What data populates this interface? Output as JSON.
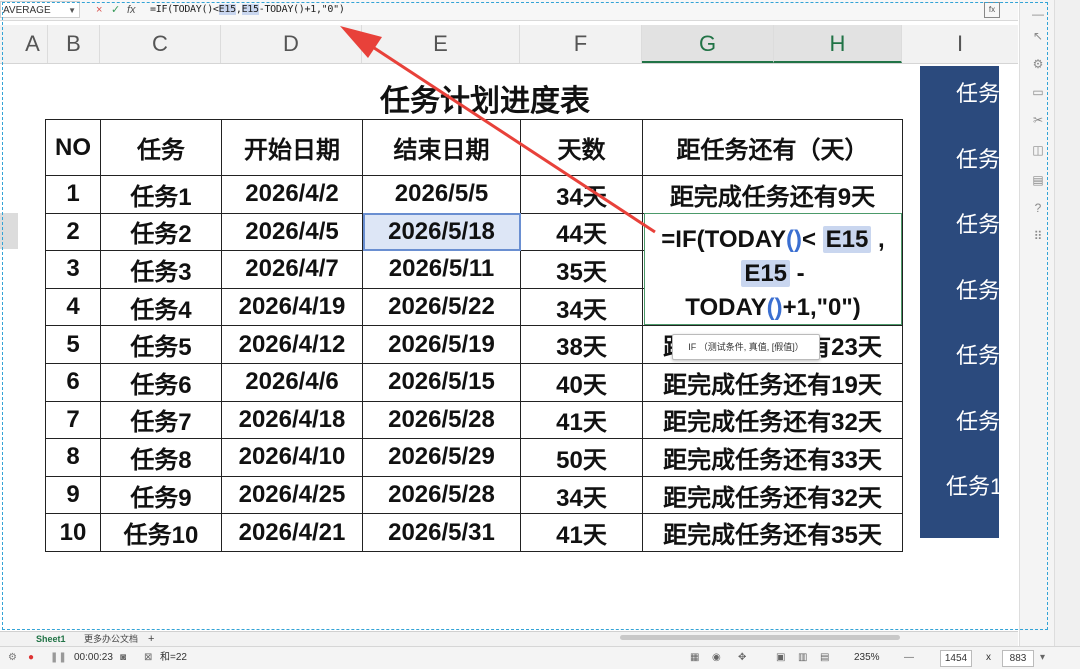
{
  "namebox": "AVERAGE",
  "formula_bar": {
    "cancel": "×",
    "confirm": "✓",
    "fx": "fx",
    "parts": [
      "=IF(TODAY()<",
      "E15",
      ",",
      "E15",
      "-TODAY()+1,\"0\")"
    ]
  },
  "columns": [
    "A",
    "B",
    "C",
    "D",
    "E",
    "F",
    "G",
    "H",
    "I"
  ],
  "title": "任务计划进度表",
  "table": {
    "headers": [
      "NO",
      "任务",
      "开始日期",
      "结束日期",
      "天数",
      "距任务还有（天）"
    ],
    "rows": [
      [
        "1",
        "任务1",
        "2026/4/2",
        "2026/5/5",
        "34天",
        "距完成任务还有9天"
      ],
      [
        "2",
        "任务2",
        "2026/4/5",
        "2026/5/18",
        "44天",
        ""
      ],
      [
        "3",
        "任务3",
        "2026/4/7",
        "2026/5/11",
        "35天",
        ""
      ],
      [
        "4",
        "任务4",
        "2026/4/19",
        "2026/5/22",
        "34天",
        ""
      ],
      [
        "5",
        "任务5",
        "2026/4/12",
        "2026/5/19",
        "38天",
        "距完成任务还有23天"
      ],
      [
        "6",
        "任务6",
        "2026/4/6",
        "2026/5/15",
        "40天",
        "距完成任务还有19天"
      ],
      [
        "7",
        "任务7",
        "2026/4/18",
        "2026/5/28",
        "41天",
        "距完成任务还有32天"
      ],
      [
        "8",
        "任务8",
        "2026/4/10",
        "2026/5/29",
        "50天",
        "距完成任务还有33天"
      ],
      [
        "9",
        "任务9",
        "2026/4/25",
        "2026/5/28",
        "34天",
        "距完成任务还有32天"
      ],
      [
        "10",
        "任务10",
        "2026/4/21",
        "2026/5/31",
        "41天",
        "距完成任务还有35天"
      ]
    ]
  },
  "editor": {
    "l1a": "=IF(TODAY",
    "l1p": "()",
    "l1b": "< ",
    "l1ref": "E15",
    "l1c": " ,",
    "l2ref": "E15",
    "l2b": " -",
    "l3a": "TODAY",
    "l3p": "()",
    "l3b": "+1,\"0\")"
  },
  "tooltip": "IF （测试条件, 真值, [假值]）",
  "blue_panel": [
    "任务",
    "任务",
    "任务",
    "任务",
    "任务",
    "任务",
    "任务1"
  ],
  "sheet_tabs": [
    "Sheet1",
    "更多办公文档",
    "+"
  ],
  "status": {
    "timer": "00:00:23",
    "sum": "和=22",
    "zoom": "235%",
    "width": "1454",
    "times": "x",
    "height": "883"
  },
  "colors": {
    "accent": "#217346",
    "panel": "#2b4a7d",
    "arrow": "#e8413a",
    "selection": "#dde6f6"
  }
}
